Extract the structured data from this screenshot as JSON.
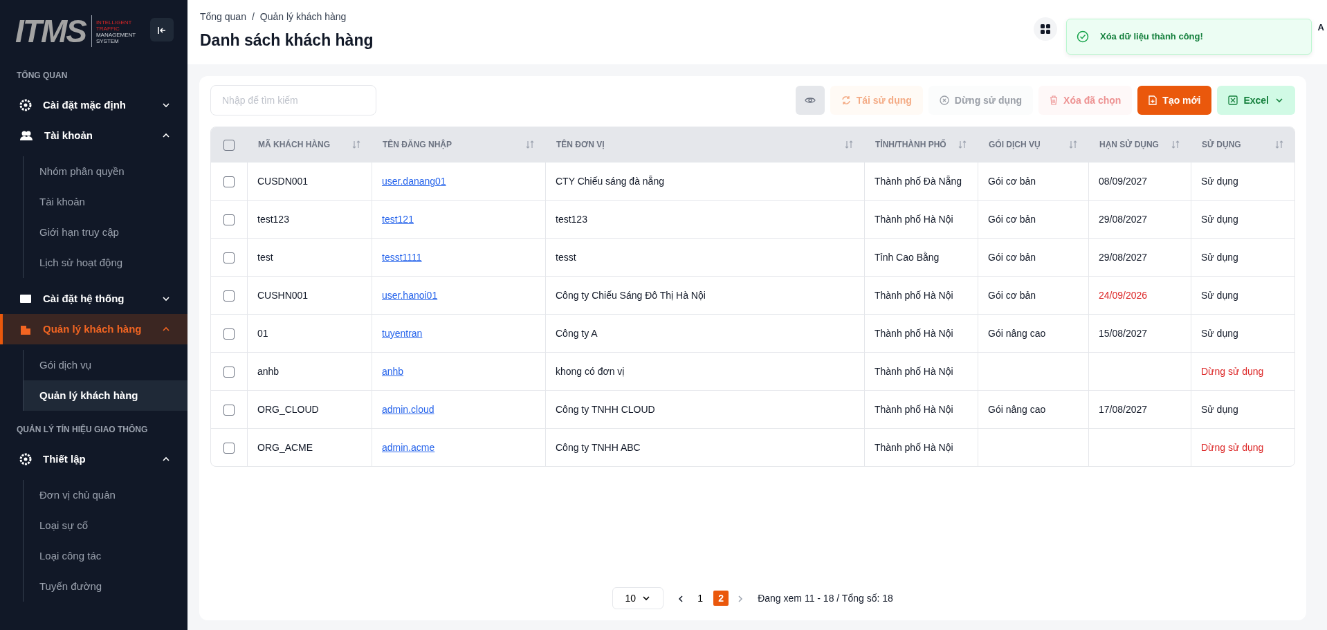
{
  "logo": {
    "mark": "ITMS",
    "tagline": [
      "INTELLIGENT",
      "TRAFFIC",
      "MANAGEMENT",
      "SYSTEM"
    ]
  },
  "sidebar": {
    "sections": [
      {
        "title": "TỔNG QUAN",
        "items": [
          {
            "label": "Cài đặt mặc định",
            "expanded": false,
            "selected": false
          },
          {
            "label": "Tài khoản",
            "expanded": true,
            "selected": false,
            "children": [
              {
                "label": "Nhóm phân quyền",
                "selected": false
              },
              {
                "label": "Tài khoản",
                "selected": false
              },
              {
                "label": "Giới hạn truy cập",
                "selected": false
              },
              {
                "label": "Lịch sử hoạt động",
                "selected": false
              }
            ]
          },
          {
            "label": "Cài đặt hệ thống",
            "expanded": false,
            "selected": false
          },
          {
            "label": "Quản lý khách hàng",
            "expanded": true,
            "selected": true,
            "children": [
              {
                "label": "Gói dịch vụ",
                "selected": false
              },
              {
                "label": "Quản lý khách hàng",
                "selected": true
              }
            ]
          }
        ]
      },
      {
        "title": "QUẢN LÝ TÍN HIỆU GIAO THÔNG",
        "items": [
          {
            "label": "Thiết lập",
            "expanded": true,
            "selected": false,
            "children": [
              {
                "label": "Đơn vị chủ quản",
                "selected": false
              },
              {
                "label": "Loại sự cố",
                "selected": false
              },
              {
                "label": "Loại công tác",
                "selected": false
              },
              {
                "label": "Tuyến đường",
                "selected": false
              }
            ]
          }
        ]
      }
    ]
  },
  "breadcrumb": {
    "separator": "/",
    "items": [
      "Tổng quan",
      "Quản lý khách hàng"
    ]
  },
  "title": "Danh sách khách hàng",
  "user": "A",
  "toast": {
    "message": "Xóa dữ liệu thành công!"
  },
  "search": {
    "placeholder": "Nhập để tìm kiếm"
  },
  "buttons": [
    {
      "kind": "view",
      "disabled": false
    },
    {
      "kind": "reuse",
      "label": "Tái sử dụng",
      "disabled": true
    },
    {
      "kind": "stop",
      "label": "Dừng sử dụng",
      "disabled": true
    },
    {
      "kind": "delete",
      "label": "Xóa đã chọn",
      "disabled": true
    },
    {
      "kind": "create",
      "label": "Tạo mới",
      "disabled": false
    },
    {
      "kind": "excel",
      "label": "Excel",
      "disabled": false
    }
  ],
  "table": {
    "header_checked": false,
    "columns": [
      "MÃ KHÁCH HÀNG",
      "TÊN ĐĂNG NHẬP",
      "TÊN ĐƠN VỊ",
      "TỈNH/THÀNH PHỐ",
      "GÓI DỊCH VỤ",
      "HẠN SỬ DỤNG",
      "SỬ DỤNG"
    ],
    "rows": [
      {
        "checked": false,
        "code": "CUSDN001",
        "username": "user.danang01",
        "unit": "CTY Chiếu sáng đà nẵng",
        "province": "Thành phố Đà Nẵng",
        "package": "Gói cơ bản",
        "expiry": "08/09/2027",
        "expiring": false,
        "status": "Sử dụng",
        "active": true
      },
      {
        "checked": false,
        "code": "test123",
        "username": "test121",
        "unit": "test123",
        "province": "Thành phố Hà Nội",
        "package": "Gói cơ bản",
        "expiry": "29/08/2027",
        "expiring": false,
        "status": "Sử dụng",
        "active": true
      },
      {
        "checked": false,
        "code": "test",
        "username": "tesst1111",
        "unit": "tesst",
        "province": "Tỉnh Cao Bằng",
        "package": "Gói cơ bản",
        "expiry": "29/08/2027",
        "expiring": false,
        "status": "Sử dụng",
        "active": true
      },
      {
        "checked": false,
        "code": "CUSHN001",
        "username": "user.hanoi01",
        "unit": "Công ty Chiếu Sáng Đô Thị Hà Nội",
        "province": "Thành phố Hà Nội",
        "package": "Gói cơ bản",
        "expiry": "24/09/2026",
        "expiring": true,
        "status": "Sử dụng",
        "active": true
      },
      {
        "checked": false,
        "code": "01",
        "username": "tuyentran",
        "unit": "Công ty A",
        "province": "Thành phố Hà Nội",
        "package": "Gói nâng cao",
        "expiry": "15/08/2027",
        "expiring": false,
        "status": "Sử dụng",
        "active": true
      },
      {
        "checked": false,
        "code": "anhb",
        "username": "anhb",
        "unit": "khong có đơn vị",
        "province": "Thành phố Hà Nội",
        "status": "Dừng sử dụng",
        "active": false
      },
      {
        "checked": false,
        "code": "ORG_CLOUD",
        "username": "admin.cloud",
        "unit": "Công ty TNHH CLOUD",
        "province": "Thành phố Hà Nội",
        "package": "Gói nâng cao",
        "expiry": "17/08/2027",
        "expiring": false,
        "status": "Sử dụng",
        "active": true
      },
      {
        "checked": false,
        "code": "ORG_ACME",
        "username": "admin.acme",
        "unit": "Công ty TNHH ABC",
        "province": "Thành phố Hà Nội",
        "status": "Dừng sử dụng",
        "active": false
      }
    ]
  },
  "pagination": {
    "page_size": "10",
    "pages": [
      {
        "label": "1",
        "selected": false
      },
      {
        "label": "2",
        "selected": true
      }
    ],
    "summary": "Đang xem 11 - 18 / Tổng số: 18"
  }
}
